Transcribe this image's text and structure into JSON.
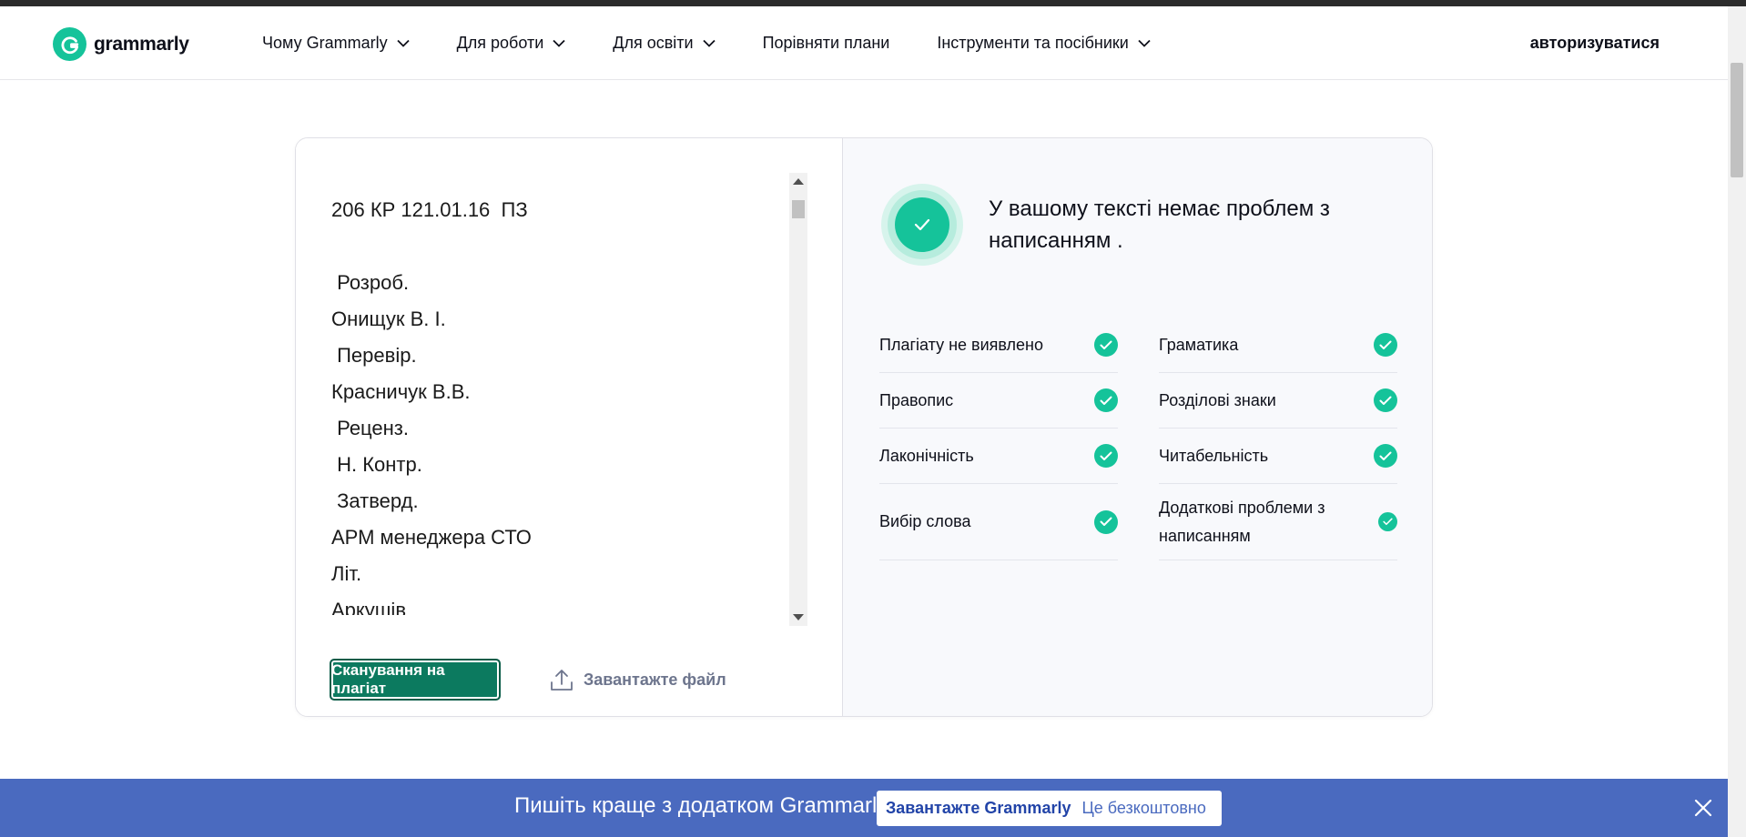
{
  "header": {
    "logo_text": "grammarly",
    "nav": [
      {
        "label": "Чому Grammarly",
        "has_dropdown": true
      },
      {
        "label": "Для роботи",
        "has_dropdown": true
      },
      {
        "label": "Для освіти",
        "has_dropdown": true
      },
      {
        "label": "Порівняти плани",
        "has_dropdown": false
      },
      {
        "label": "Інструменти та посібники",
        "has_dropdown": true
      }
    ],
    "login_label": "авторизуватися"
  },
  "editor": {
    "lines": [
      "206 КР 121.01.16  ПЗ",
      " Розроб.",
      "Онищук В. І.",
      " Перевір.",
      "Красничук В.В.",
      " Реценз.",
      " Н. Контр.",
      " Затверд.",
      "АРМ менеджера СТО",
      "Літ.",
      "Аркушів"
    ],
    "scan_button": "Сканування на плагіат",
    "upload_label": "Завантажте файл"
  },
  "results": {
    "summary": "У вашому тексті немає проблем з написанням .",
    "left_checks": [
      "Плагіату не виявлено",
      "Правопис",
      "Лаконічність",
      "Вибір слова"
    ],
    "right_checks": [
      "Граматика",
      "Розділові знаки",
      "Читабельність",
      "Додаткові проблеми з написанням"
    ]
  },
  "banner": {
    "text": "Пишіть краще з додатком Grammarly.",
    "button_strong": "Завантажте Grammarly",
    "button_soft": "Це безкоштовно"
  },
  "colors": {
    "brand": "#15c39a",
    "scan_button": "#0c7a5f",
    "banner": "#4a6abf"
  },
  "icons": {
    "logo": "grammarly-g-icon",
    "dropdown": "chevron-down-icon",
    "check": "check-circle-icon",
    "upload": "upload-icon",
    "close": "close-icon"
  }
}
